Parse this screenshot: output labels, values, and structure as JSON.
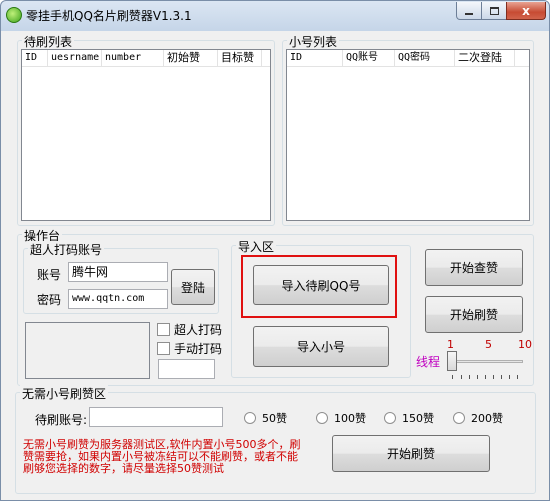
{
  "window": {
    "title": "零挂手机QQ名片刷赞器V1.3.1",
    "close_glyph": "x"
  },
  "pending_list": {
    "legend": "待刷列表",
    "columns": [
      "ID",
      "uesrname",
      "number",
      "初始赞",
      "目标赞"
    ]
  },
  "account_list": {
    "legend": "小号列表",
    "columns": [
      "ID",
      "QQ账号",
      "QQ密码",
      "二次登陆"
    ]
  },
  "console": {
    "legend": "操作台",
    "captcha_group": {
      "legend": "超人打码账号",
      "account_label": "账号",
      "account_value": "腾牛网",
      "password_label": "密码",
      "password_value": "www.qqtn.com",
      "login_button": "登陆"
    },
    "checkbox_superman": "超人打码",
    "checkbox_manual": "手动打码",
    "import_group": {
      "legend": "导入区",
      "import_pending_button": "导入待刷QQ号",
      "import_accounts_button": "导入小号"
    },
    "start_query_button": "开始查赞",
    "start_like_button": "开始刷赞",
    "thread_label": "线程",
    "thread_marks": [
      "1",
      "5",
      "10"
    ],
    "thread_value": 1
  },
  "no_account": {
    "legend": "无需小号刷赞区",
    "pending_label": "待刷账号:",
    "pending_value": "",
    "options": [
      "50赞",
      "100赞",
      "150赞",
      "200赞"
    ],
    "notice_lines": [
      "无需小号刷赞为服务器测试区,软件内置小号500多个，刷",
      "赞需要抢，如果内置小号被冻结可以不能刷赞，或者不能",
      "刷够您选择的数字，请尽量选择50赞测试"
    ],
    "start_button": "开始刷赞"
  },
  "colors": {
    "highlight": "#e01010",
    "notice": "#d00000",
    "thread_label": "#c000c0",
    "slider_marks": "#c00000"
  }
}
